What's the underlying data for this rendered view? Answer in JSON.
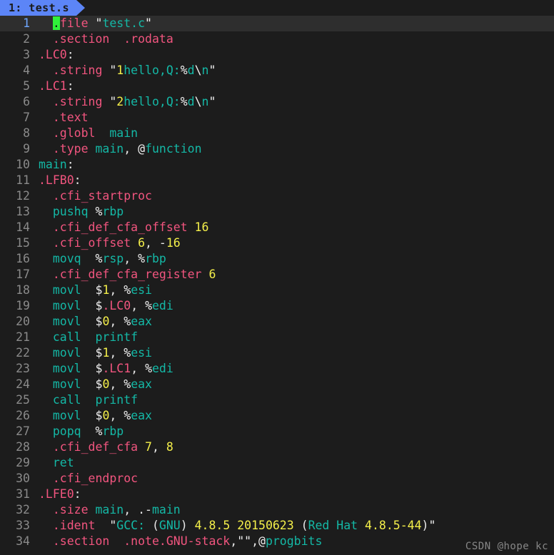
{
  "window": {
    "title": "test.s",
    "background_color": "#1c1c1c"
  },
  "tabbar": {
    "active_tab": {
      "label": "1: test.s",
      "index": "1",
      "filename": "test.s",
      "background_color": "#5c85f7",
      "text_color": "#1a1a1a"
    }
  },
  "colors": {
    "background": "#1c1c1c",
    "current_line_background": "#2e2e2e",
    "gutter_text": "#8a8a8a",
    "gutter_current": "#6fa8ff",
    "directive": "#f2557f",
    "instruction": "#14b8a6",
    "string": "#14b8a6",
    "number": "#f5f04a",
    "punctuation": "#e8e8e8",
    "cursor": "#2ff13a",
    "watermark": "#9a9a9a"
  },
  "editor": {
    "cursor_line": 1,
    "cursor_column": 2,
    "total_lines": 34,
    "lines": [
      {
        "num": "1",
        "current": true,
        "tokens": [
          {
            "t": "  ",
            "c": "t-plain"
          },
          {
            "t": ".",
            "c": "t-dir cursor"
          },
          {
            "t": "file",
            "c": "t-dir"
          },
          {
            "t": " ",
            "c": "t-plain"
          },
          {
            "t": "\"",
            "c": "t-sigil"
          },
          {
            "t": "test.c",
            "c": "t-string"
          },
          {
            "t": "\"",
            "c": "t-sigil"
          }
        ]
      },
      {
        "num": "2",
        "current": false,
        "tokens": [
          {
            "t": "  ",
            "c": "t-plain"
          },
          {
            "t": ".section",
            "c": "t-dir"
          },
          {
            "t": "  ",
            "c": "t-plain"
          },
          {
            "t": ".rodata",
            "c": "t-dir"
          }
        ]
      },
      {
        "num": "3",
        "current": false,
        "tokens": [
          {
            "t": ".LC0",
            "c": "t-label"
          },
          {
            "t": ":",
            "c": "t-punct"
          }
        ]
      },
      {
        "num": "4",
        "current": false,
        "tokens": [
          {
            "t": "  ",
            "c": "t-plain"
          },
          {
            "t": ".string",
            "c": "t-dir"
          },
          {
            "t": " ",
            "c": "t-plain"
          },
          {
            "t": "\"",
            "c": "t-sigil"
          },
          {
            "t": "1",
            "c": "t-num"
          },
          {
            "t": "hello,Q:",
            "c": "t-string"
          },
          {
            "t": "%",
            "c": "t-sigil"
          },
          {
            "t": "d",
            "c": "t-string"
          },
          {
            "t": "\\",
            "c": "t-sigil"
          },
          {
            "t": "n",
            "c": "t-string"
          },
          {
            "t": "\"",
            "c": "t-sigil"
          }
        ]
      },
      {
        "num": "5",
        "current": false,
        "tokens": [
          {
            "t": ".LC1",
            "c": "t-label"
          },
          {
            "t": ":",
            "c": "t-punct"
          }
        ]
      },
      {
        "num": "6",
        "current": false,
        "tokens": [
          {
            "t": "  ",
            "c": "t-plain"
          },
          {
            "t": ".string",
            "c": "t-dir"
          },
          {
            "t": " ",
            "c": "t-plain"
          },
          {
            "t": "\"",
            "c": "t-sigil"
          },
          {
            "t": "2",
            "c": "t-num"
          },
          {
            "t": "hello,Q:",
            "c": "t-string"
          },
          {
            "t": "%",
            "c": "t-sigil"
          },
          {
            "t": "d",
            "c": "t-string"
          },
          {
            "t": "\\",
            "c": "t-sigil"
          },
          {
            "t": "n",
            "c": "t-string"
          },
          {
            "t": "\"",
            "c": "t-sigil"
          }
        ]
      },
      {
        "num": "7",
        "current": false,
        "tokens": [
          {
            "t": "  ",
            "c": "t-plain"
          },
          {
            "t": ".text",
            "c": "t-dir"
          }
        ]
      },
      {
        "num": "8",
        "current": false,
        "tokens": [
          {
            "t": "  ",
            "c": "t-plain"
          },
          {
            "t": ".globl",
            "c": "t-dir"
          },
          {
            "t": "  ",
            "c": "t-plain"
          },
          {
            "t": "main",
            "c": "t-ident"
          }
        ]
      },
      {
        "num": "9",
        "current": false,
        "tokens": [
          {
            "t": "  ",
            "c": "t-plain"
          },
          {
            "t": ".type",
            "c": "t-dir"
          },
          {
            "t": " ",
            "c": "t-plain"
          },
          {
            "t": "main",
            "c": "t-ident"
          },
          {
            "t": ", ",
            "c": "t-punct"
          },
          {
            "t": "@",
            "c": "t-sigil"
          },
          {
            "t": "function",
            "c": "t-ident"
          }
        ]
      },
      {
        "num": "10",
        "current": false,
        "tokens": [
          {
            "t": "main",
            "c": "t-ident"
          },
          {
            "t": ":",
            "c": "t-punct"
          }
        ]
      },
      {
        "num": "11",
        "current": false,
        "tokens": [
          {
            "t": ".LFB0",
            "c": "t-label"
          },
          {
            "t": ":",
            "c": "t-punct"
          }
        ]
      },
      {
        "num": "12",
        "current": false,
        "tokens": [
          {
            "t": "  ",
            "c": "t-plain"
          },
          {
            "t": ".cfi_startproc",
            "c": "t-dir"
          }
        ]
      },
      {
        "num": "13",
        "current": false,
        "tokens": [
          {
            "t": "  ",
            "c": "t-plain"
          },
          {
            "t": "pushq",
            "c": "t-instr"
          },
          {
            "t": " ",
            "c": "t-plain"
          },
          {
            "t": "%",
            "c": "t-sigil"
          },
          {
            "t": "rbp",
            "c": "t-reg"
          }
        ]
      },
      {
        "num": "14",
        "current": false,
        "tokens": [
          {
            "t": "  ",
            "c": "t-plain"
          },
          {
            "t": ".cfi_def_cfa_offset",
            "c": "t-dir"
          },
          {
            "t": " ",
            "c": "t-plain"
          },
          {
            "t": "16",
            "c": "t-num"
          }
        ]
      },
      {
        "num": "15",
        "current": false,
        "tokens": [
          {
            "t": "  ",
            "c": "t-plain"
          },
          {
            "t": ".cfi_offset",
            "c": "t-dir"
          },
          {
            "t": " ",
            "c": "t-plain"
          },
          {
            "t": "6",
            "c": "t-num"
          },
          {
            "t": ", ",
            "c": "t-punct"
          },
          {
            "t": "-",
            "c": "t-punct"
          },
          {
            "t": "16",
            "c": "t-num"
          }
        ]
      },
      {
        "num": "16",
        "current": false,
        "tokens": [
          {
            "t": "  ",
            "c": "t-plain"
          },
          {
            "t": "movq",
            "c": "t-instr"
          },
          {
            "t": "  ",
            "c": "t-plain"
          },
          {
            "t": "%",
            "c": "t-sigil"
          },
          {
            "t": "rsp",
            "c": "t-reg"
          },
          {
            "t": ", ",
            "c": "t-punct"
          },
          {
            "t": "%",
            "c": "t-sigil"
          },
          {
            "t": "rbp",
            "c": "t-reg"
          }
        ]
      },
      {
        "num": "17",
        "current": false,
        "tokens": [
          {
            "t": "  ",
            "c": "t-plain"
          },
          {
            "t": ".cfi_def_cfa_register",
            "c": "t-dir"
          },
          {
            "t": " ",
            "c": "t-plain"
          },
          {
            "t": "6",
            "c": "t-num"
          }
        ]
      },
      {
        "num": "18",
        "current": false,
        "tokens": [
          {
            "t": "  ",
            "c": "t-plain"
          },
          {
            "t": "movl",
            "c": "t-instr"
          },
          {
            "t": "  ",
            "c": "t-plain"
          },
          {
            "t": "$",
            "c": "t-sigil"
          },
          {
            "t": "1",
            "c": "t-num"
          },
          {
            "t": ", ",
            "c": "t-punct"
          },
          {
            "t": "%",
            "c": "t-sigil"
          },
          {
            "t": "esi",
            "c": "t-reg"
          }
        ]
      },
      {
        "num": "19",
        "current": false,
        "tokens": [
          {
            "t": "  ",
            "c": "t-plain"
          },
          {
            "t": "movl",
            "c": "t-instr"
          },
          {
            "t": "  ",
            "c": "t-plain"
          },
          {
            "t": "$",
            "c": "t-sigil"
          },
          {
            "t": ".LC0",
            "c": "t-label"
          },
          {
            "t": ", ",
            "c": "t-punct"
          },
          {
            "t": "%",
            "c": "t-sigil"
          },
          {
            "t": "edi",
            "c": "t-reg"
          }
        ]
      },
      {
        "num": "20",
        "current": false,
        "tokens": [
          {
            "t": "  ",
            "c": "t-plain"
          },
          {
            "t": "movl",
            "c": "t-instr"
          },
          {
            "t": "  ",
            "c": "t-plain"
          },
          {
            "t": "$",
            "c": "t-sigil"
          },
          {
            "t": "0",
            "c": "t-num"
          },
          {
            "t": ", ",
            "c": "t-punct"
          },
          {
            "t": "%",
            "c": "t-sigil"
          },
          {
            "t": "eax",
            "c": "t-reg"
          }
        ]
      },
      {
        "num": "21",
        "current": false,
        "tokens": [
          {
            "t": "  ",
            "c": "t-plain"
          },
          {
            "t": "call",
            "c": "t-instr"
          },
          {
            "t": "  ",
            "c": "t-plain"
          },
          {
            "t": "printf",
            "c": "t-ident"
          }
        ]
      },
      {
        "num": "22",
        "current": false,
        "tokens": [
          {
            "t": "  ",
            "c": "t-plain"
          },
          {
            "t": "movl",
            "c": "t-instr"
          },
          {
            "t": "  ",
            "c": "t-plain"
          },
          {
            "t": "$",
            "c": "t-sigil"
          },
          {
            "t": "1",
            "c": "t-num"
          },
          {
            "t": ", ",
            "c": "t-punct"
          },
          {
            "t": "%",
            "c": "t-sigil"
          },
          {
            "t": "esi",
            "c": "t-reg"
          }
        ]
      },
      {
        "num": "23",
        "current": false,
        "tokens": [
          {
            "t": "  ",
            "c": "t-plain"
          },
          {
            "t": "movl",
            "c": "t-instr"
          },
          {
            "t": "  ",
            "c": "t-plain"
          },
          {
            "t": "$",
            "c": "t-sigil"
          },
          {
            "t": ".LC1",
            "c": "t-label"
          },
          {
            "t": ", ",
            "c": "t-punct"
          },
          {
            "t": "%",
            "c": "t-sigil"
          },
          {
            "t": "edi",
            "c": "t-reg"
          }
        ]
      },
      {
        "num": "24",
        "current": false,
        "tokens": [
          {
            "t": "  ",
            "c": "t-plain"
          },
          {
            "t": "movl",
            "c": "t-instr"
          },
          {
            "t": "  ",
            "c": "t-plain"
          },
          {
            "t": "$",
            "c": "t-sigil"
          },
          {
            "t": "0",
            "c": "t-num"
          },
          {
            "t": ", ",
            "c": "t-punct"
          },
          {
            "t": "%",
            "c": "t-sigil"
          },
          {
            "t": "eax",
            "c": "t-reg"
          }
        ]
      },
      {
        "num": "25",
        "current": false,
        "tokens": [
          {
            "t": "  ",
            "c": "t-plain"
          },
          {
            "t": "call",
            "c": "t-instr"
          },
          {
            "t": "  ",
            "c": "t-plain"
          },
          {
            "t": "printf",
            "c": "t-ident"
          }
        ]
      },
      {
        "num": "26",
        "current": false,
        "tokens": [
          {
            "t": "  ",
            "c": "t-plain"
          },
          {
            "t": "movl",
            "c": "t-instr"
          },
          {
            "t": "  ",
            "c": "t-plain"
          },
          {
            "t": "$",
            "c": "t-sigil"
          },
          {
            "t": "0",
            "c": "t-num"
          },
          {
            "t": ", ",
            "c": "t-punct"
          },
          {
            "t": "%",
            "c": "t-sigil"
          },
          {
            "t": "eax",
            "c": "t-reg"
          }
        ]
      },
      {
        "num": "27",
        "current": false,
        "tokens": [
          {
            "t": "  ",
            "c": "t-plain"
          },
          {
            "t": "popq",
            "c": "t-instr"
          },
          {
            "t": "  ",
            "c": "t-plain"
          },
          {
            "t": "%",
            "c": "t-sigil"
          },
          {
            "t": "rbp",
            "c": "t-reg"
          }
        ]
      },
      {
        "num": "28",
        "current": false,
        "tokens": [
          {
            "t": "  ",
            "c": "t-plain"
          },
          {
            "t": ".cfi_def_cfa",
            "c": "t-dir"
          },
          {
            "t": " ",
            "c": "t-plain"
          },
          {
            "t": "7",
            "c": "t-num"
          },
          {
            "t": ", ",
            "c": "t-punct"
          },
          {
            "t": "8",
            "c": "t-num"
          }
        ]
      },
      {
        "num": "29",
        "current": false,
        "tokens": [
          {
            "t": "  ",
            "c": "t-plain"
          },
          {
            "t": "ret",
            "c": "t-instr"
          }
        ]
      },
      {
        "num": "30",
        "current": false,
        "tokens": [
          {
            "t": "  ",
            "c": "t-plain"
          },
          {
            "t": ".cfi_endproc",
            "c": "t-dir"
          }
        ]
      },
      {
        "num": "31",
        "current": false,
        "tokens": [
          {
            "t": ".LFE0",
            "c": "t-label"
          },
          {
            "t": ":",
            "c": "t-punct"
          }
        ]
      },
      {
        "num": "32",
        "current": false,
        "tokens": [
          {
            "t": "  ",
            "c": "t-plain"
          },
          {
            "t": ".size",
            "c": "t-dir"
          },
          {
            "t": " ",
            "c": "t-plain"
          },
          {
            "t": "main",
            "c": "t-ident"
          },
          {
            "t": ", ",
            "c": "t-punct"
          },
          {
            "t": ".-",
            "c": "t-punct"
          },
          {
            "t": "main",
            "c": "t-ident"
          }
        ]
      },
      {
        "num": "33",
        "current": false,
        "tokens": [
          {
            "t": "  ",
            "c": "t-plain"
          },
          {
            "t": ".ident",
            "c": "t-dir"
          },
          {
            "t": "  ",
            "c": "t-plain"
          },
          {
            "t": "\"",
            "c": "t-sigil"
          },
          {
            "t": "GCC: ",
            "c": "t-string"
          },
          {
            "t": "(",
            "c": "t-punct"
          },
          {
            "t": "GNU",
            "c": "t-string"
          },
          {
            "t": ")",
            "c": "t-punct"
          },
          {
            "t": " ",
            "c": "t-plain"
          },
          {
            "t": "4.8.5",
            "c": "t-num"
          },
          {
            "t": " ",
            "c": "t-plain"
          },
          {
            "t": "20150623",
            "c": "t-num"
          },
          {
            "t": " ",
            "c": "t-plain"
          },
          {
            "t": "(",
            "c": "t-punct"
          },
          {
            "t": "Red Hat ",
            "c": "t-string"
          },
          {
            "t": "4.8.5-44",
            "c": "t-num"
          },
          {
            "t": ")",
            "c": "t-punct"
          },
          {
            "t": "\"",
            "c": "t-sigil"
          }
        ]
      },
      {
        "num": "34",
        "current": false,
        "tokens": [
          {
            "t": "  ",
            "c": "t-plain"
          },
          {
            "t": ".section",
            "c": "t-dir"
          },
          {
            "t": "  ",
            "c": "t-plain"
          },
          {
            "t": ".note.GNU-stack",
            "c": "t-dir"
          },
          {
            "t": ",",
            "c": "t-punct"
          },
          {
            "t": "\"\"",
            "c": "t-sigil"
          },
          {
            "t": ",",
            "c": "t-punct"
          },
          {
            "t": "@",
            "c": "t-sigil"
          },
          {
            "t": "progbits",
            "c": "t-ident"
          }
        ]
      }
    ]
  },
  "watermark": {
    "text": "CSDN @hope kc"
  }
}
